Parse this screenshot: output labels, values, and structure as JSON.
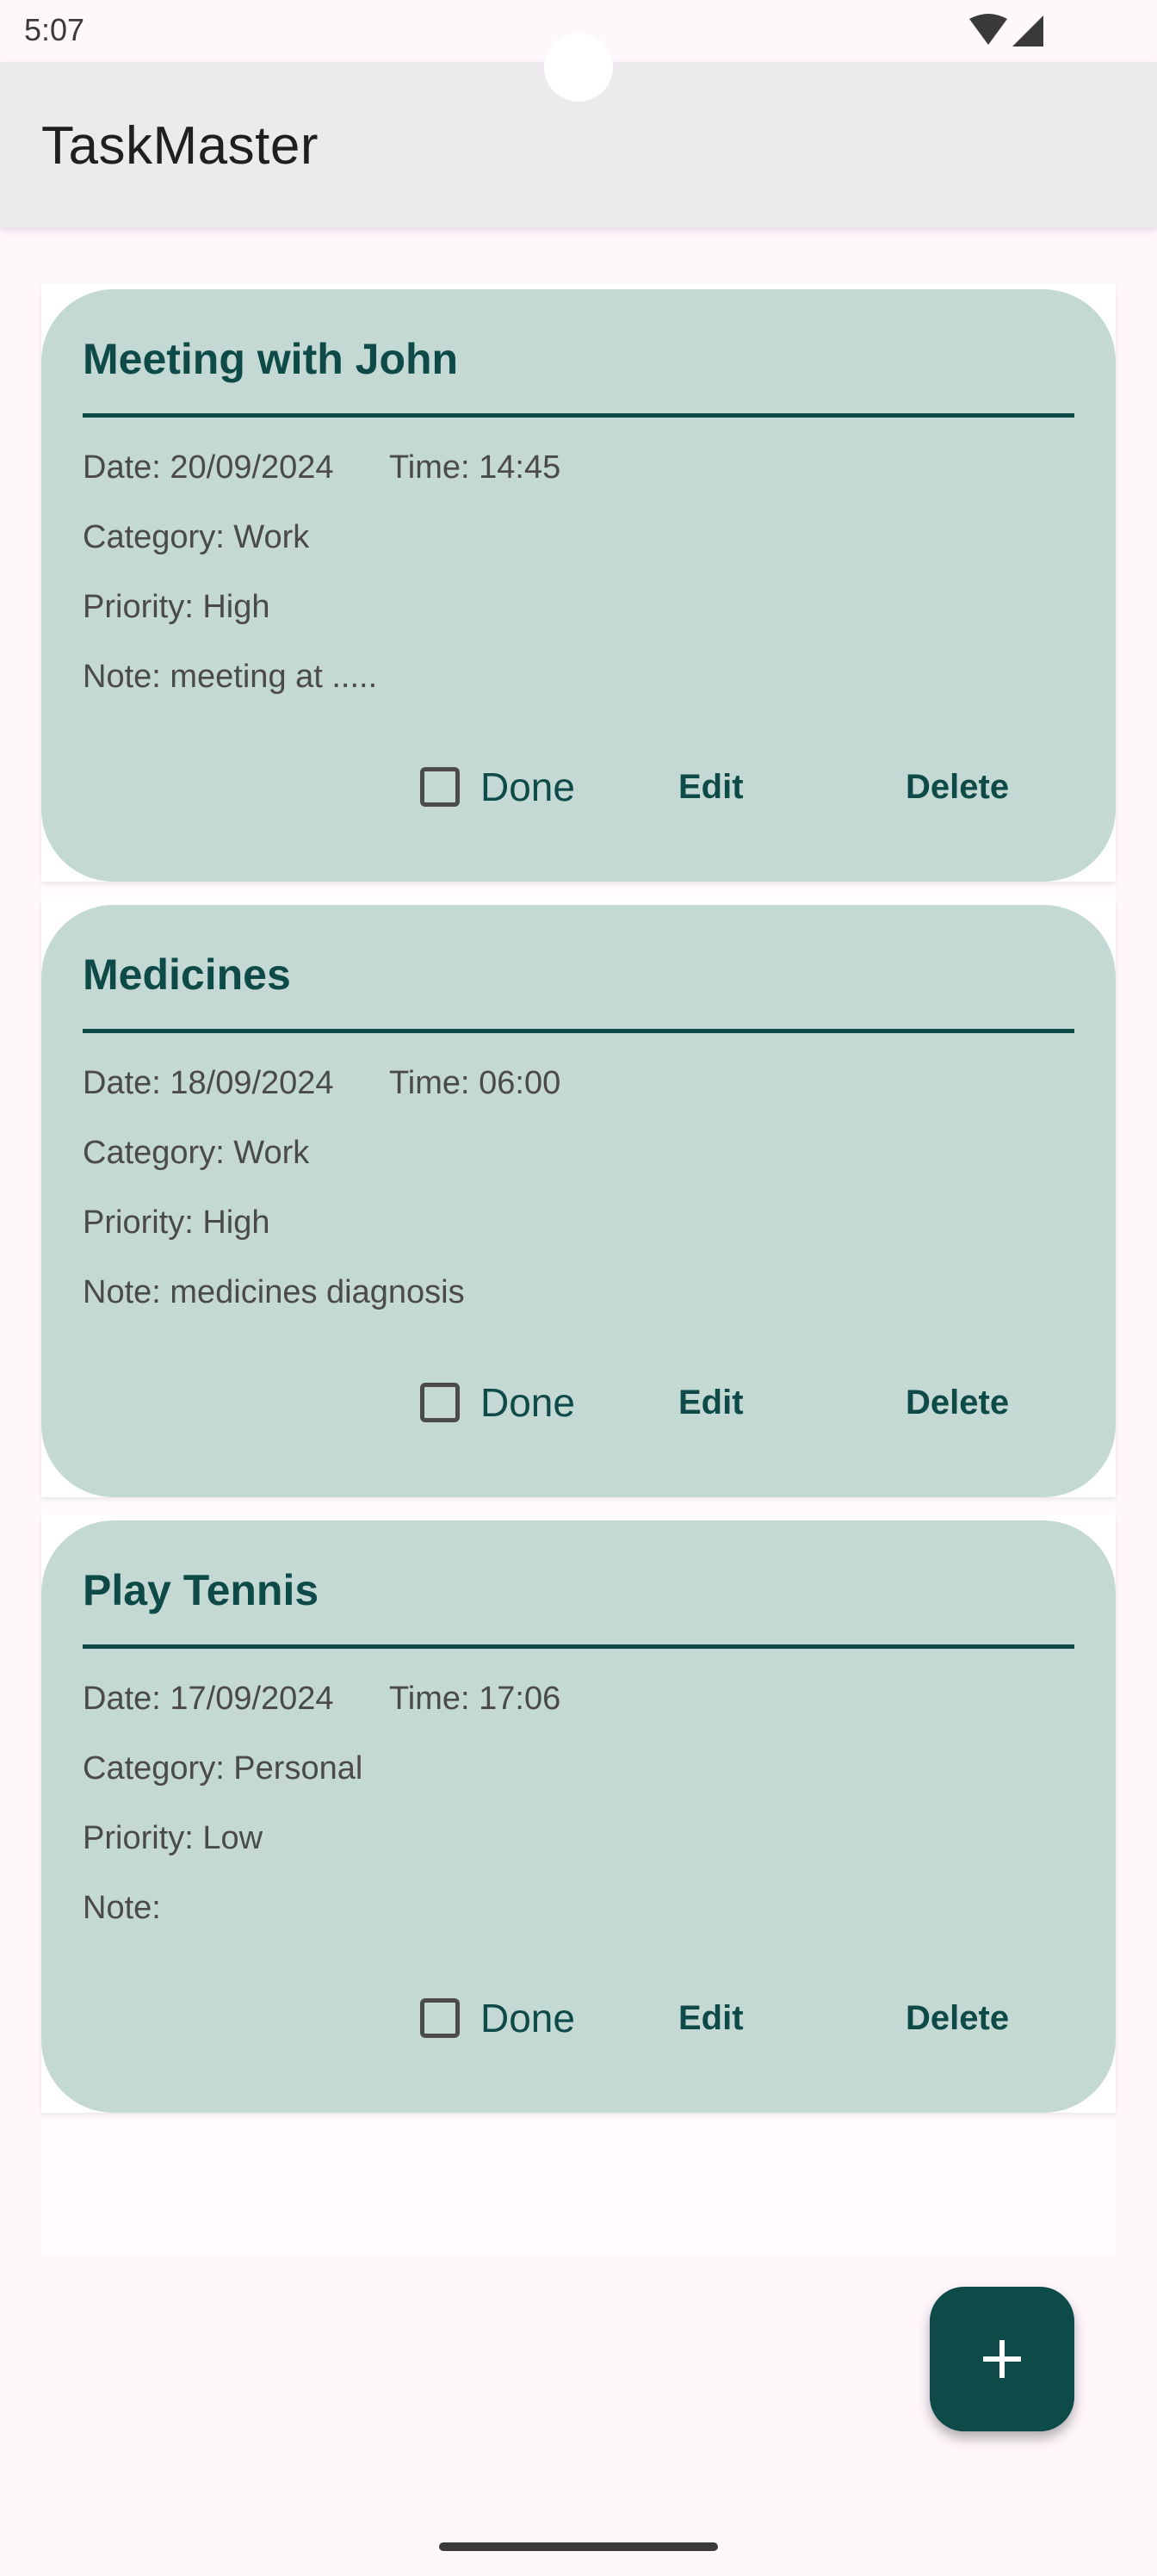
{
  "status_bar": {
    "time": "5:07",
    "icons": [
      "wifi-icon",
      "cell-signal-icon"
    ]
  },
  "app_bar": {
    "title": "TaskMaster"
  },
  "labels": {
    "done": "Done",
    "edit": "Edit",
    "delete": "Delete"
  },
  "tasks": [
    {
      "title": "Meeting with John",
      "date": "Date: 20/09/2024",
      "time": "Time: 14:45",
      "category": "Category: Work",
      "priority": "Priority: High",
      "note": "Note: meeting at .....",
      "done": false
    },
    {
      "title": "Medicines",
      "date": "Date: 18/09/2024",
      "time": "Time: 06:00",
      "category": "Category: Work",
      "priority": "Priority: High",
      "note": "Note: medicines diagnosis",
      "done": false
    },
    {
      "title": "Play Tennis",
      "date": "Date: 17/09/2024",
      "time": "Time: 17:06",
      "category": "Category: Personal",
      "priority": "Priority: Low",
      "note": "Note:",
      "done": false
    }
  ],
  "fab": {
    "icon": "plus-icon"
  },
  "colors": {
    "accent": "#0d4a48",
    "card_background": "#c5d9d4",
    "app_bar": "#eceaed",
    "page_background": "#fef7fc"
  }
}
